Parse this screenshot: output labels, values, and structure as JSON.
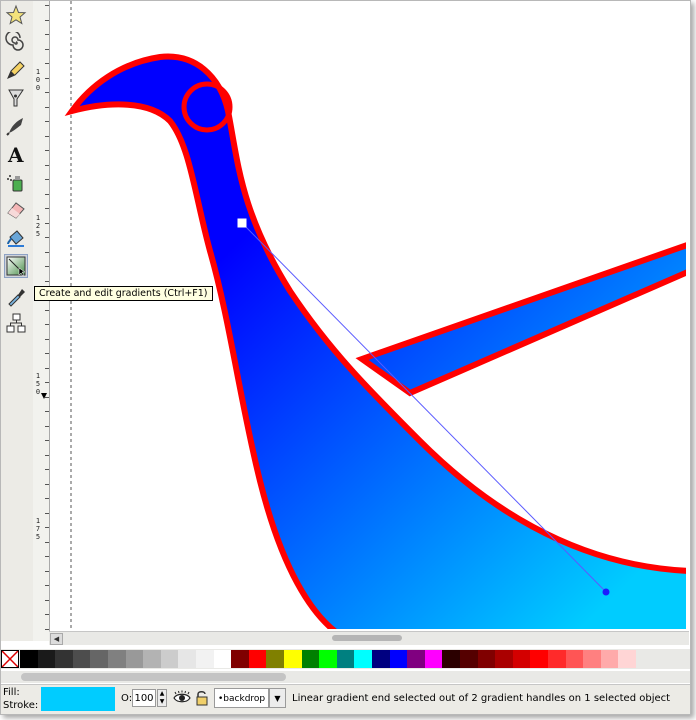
{
  "toolbox": {
    "tools": [
      {
        "name": "star-tool"
      },
      {
        "name": "spiral-tool"
      },
      {
        "name": "pencil-tool"
      },
      {
        "name": "pen-tool"
      },
      {
        "name": "calligraphy-tool"
      },
      {
        "name": "text-tool",
        "glyph": "A"
      },
      {
        "name": "spray-tool"
      },
      {
        "name": "eraser-tool"
      },
      {
        "name": "paint-bucket-tool"
      },
      {
        "name": "gradient-tool",
        "active": true
      },
      {
        "name": "dropper-tool"
      },
      {
        "name": "connector-tool"
      }
    ]
  },
  "ruler": {
    "labels": [
      "100",
      "125",
      "150",
      "175"
    ]
  },
  "tooltip": {
    "text": "Create and edit gradients (Ctrl+F1)"
  },
  "canvas": {
    "gradient_start_color": "#0000ff",
    "gradient_end_color": "#00ccff",
    "stroke_color": "#ff0000"
  },
  "palette": {
    "colors": [
      "#000000",
      "#1a1a1a",
      "#333333",
      "#4d4d4d",
      "#666666",
      "#808080",
      "#999999",
      "#b3b3b3",
      "#cccccc",
      "#e6e6e6",
      "#f2f2f2",
      "#ffffff",
      "#800000",
      "#ff0000",
      "#808000",
      "#ffff00",
      "#008000",
      "#00ff00",
      "#008080",
      "#00ffff",
      "#000080",
      "#0000ff",
      "#800080",
      "#ff00ff",
      "#2b0000",
      "#550000",
      "#800000",
      "#aa0000",
      "#d40000",
      "#ff0000",
      "#ff2a2a",
      "#ff5555",
      "#ff8080",
      "#ffaaaa",
      "#ffd5d5"
    ]
  },
  "status": {
    "fill_label": "Fill:",
    "stroke_label": "Stroke:",
    "fill_color": "#00ccff",
    "opacity_label": "O:",
    "opacity_value": "100",
    "layer_name": "•backdrop",
    "message": "Linear gradient end selected out of 2 gradient handles on 1 selected object"
  }
}
